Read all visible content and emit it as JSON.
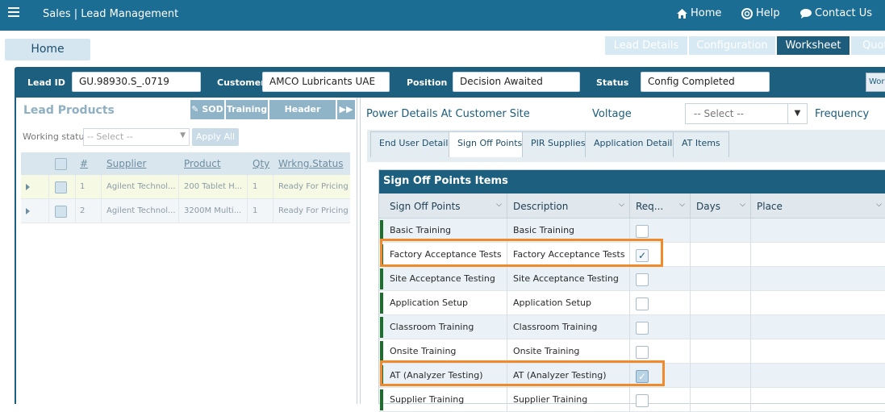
{
  "header": {
    "menu_icon": "hamburger-icon",
    "app_title": "Sales  |  Lead Management",
    "nav": [
      {
        "label": "Home",
        "icon": "home-icon"
      },
      {
        "label": "Help",
        "icon": "lifebuoy-icon"
      },
      {
        "label": "Contact Us",
        "icon": "chat-icon"
      }
    ]
  },
  "tabs": {
    "home_label": "Home",
    "right": [
      {
        "label": "Lead Details",
        "active": false
      },
      {
        "label": "Configuration",
        "active": false
      },
      {
        "label": "Worksheet",
        "active": true
      },
      {
        "label": "Quot",
        "active": false
      }
    ]
  },
  "lead_bar": {
    "lead_id_label": "Lead ID",
    "lead_id_value": "GU.98930.S_.0719",
    "customer_label": "Customer",
    "customer_value": "AMCO Lubricants UAE",
    "position_label": "Position",
    "position_value": "Decision Awaited",
    "status_label": "Status",
    "status_value": "Config Completed",
    "cut_button_label": "Wor"
  },
  "lead_products": {
    "title": "Lead Products",
    "buttons": {
      "sod": "SOD",
      "training": "Training",
      "header_details": "Header Details"
    },
    "working_status_label": "Working status",
    "working_status_placeholder": "-- Select --",
    "apply_all_label": "Apply All",
    "columns": [
      "#",
      "Supplier",
      "Product",
      "Qty",
      "Wrkng.Status"
    ],
    "rows": [
      {
        "num": "1",
        "supplier": "Agilent Technol...",
        "product": "200 Tablet H...",
        "qty": "1",
        "status": "Ready For Pricing"
      },
      {
        "num": "2",
        "supplier": "Agilent Technol...",
        "product": "3200M Multi...",
        "qty": "1",
        "status": "Ready For Pricing"
      }
    ]
  },
  "power": {
    "title": "Power Details At Customer Site",
    "voltage_label": "Voltage",
    "voltage_placeholder": "-- Select --",
    "frequency_label": "Frequency"
  },
  "subtabs": [
    {
      "label": "End User Details",
      "active": false
    },
    {
      "label": "Sign Off Points",
      "active": true
    },
    {
      "label": "PIR Supplies",
      "active": false
    },
    {
      "label": "Application Details",
      "active": false
    },
    {
      "label": "AT Items",
      "active": false
    }
  ],
  "sign_off": {
    "title": "Sign Off Points Items",
    "columns": [
      "Sign Off Points",
      "Description",
      "Req...",
      "Days",
      "Place"
    ],
    "rows": [
      {
        "point": "Basic Training",
        "description": "Basic Training",
        "required": false
      },
      {
        "point": "Factory Acceptance Tests",
        "description": "Factory Acceptance Tests",
        "required": true
      },
      {
        "point": "Site Acceptance Testing",
        "description": "Site Acceptance Testing",
        "required": false
      },
      {
        "point": "Application Setup",
        "description": "Application Setup",
        "required": false
      },
      {
        "point": "Classroom Training",
        "description": "Classroom Training",
        "required": false
      },
      {
        "point": "Onsite Training",
        "description": "Onsite Training",
        "required": false
      },
      {
        "point": "AT (Analyzer Testing)",
        "description": "AT (Analyzer Testing)",
        "required": true
      },
      {
        "point": "Supplier Training",
        "description": "Supplier Training",
        "required": false
      }
    ]
  },
  "colors": {
    "header": "#1c6d93",
    "panel_bar": "#1d5f7f",
    "highlight": "#f08a2b",
    "row_marker": "#1a6f2a"
  }
}
